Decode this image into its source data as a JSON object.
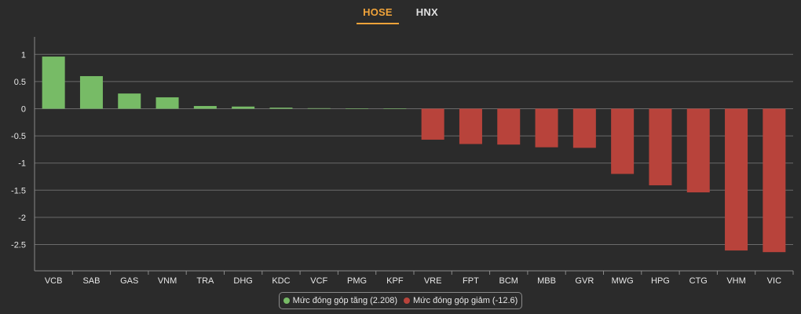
{
  "tabs": [
    {
      "label": "HOSE",
      "active": true
    },
    {
      "label": "HNX",
      "active": false
    }
  ],
  "legend": {
    "up_label": "Mức đóng góp tăng (2.208)",
    "down_label": "Mức đóng góp giảm (-12.6)"
  },
  "colors": {
    "up": "#77bb66",
    "down": "#b8433b",
    "accent": "#f0a33a",
    "grid": "#6a6a6a",
    "background": "#2b2b2b"
  },
  "chart_data": {
    "type": "bar",
    "categories": [
      "VCB",
      "SAB",
      "GAS",
      "VNM",
      "TRA",
      "DHG",
      "KDC",
      "VCF",
      "PMG",
      "KPF",
      "VRE",
      "FPT",
      "BCM",
      "MBB",
      "GVR",
      "MWG",
      "HPG",
      "CTG",
      "VHM",
      "VIC"
    ],
    "values": [
      0.96,
      0.6,
      0.28,
      0.21,
      0.05,
      0.04,
      0.02,
      0.01,
      0.005,
      0.005,
      -0.57,
      -0.65,
      -0.66,
      -0.71,
      -0.72,
      -1.2,
      -1.41,
      -1.54,
      -2.61,
      -2.64
    ],
    "yticks": [
      "1",
      "0.5",
      "0",
      "-0.5",
      "-1",
      "-1.5",
      "-2",
      "-2.5"
    ],
    "ylim": [
      -3,
      1.3
    ],
    "grid": true,
    "legend_position": "bottom-center"
  }
}
